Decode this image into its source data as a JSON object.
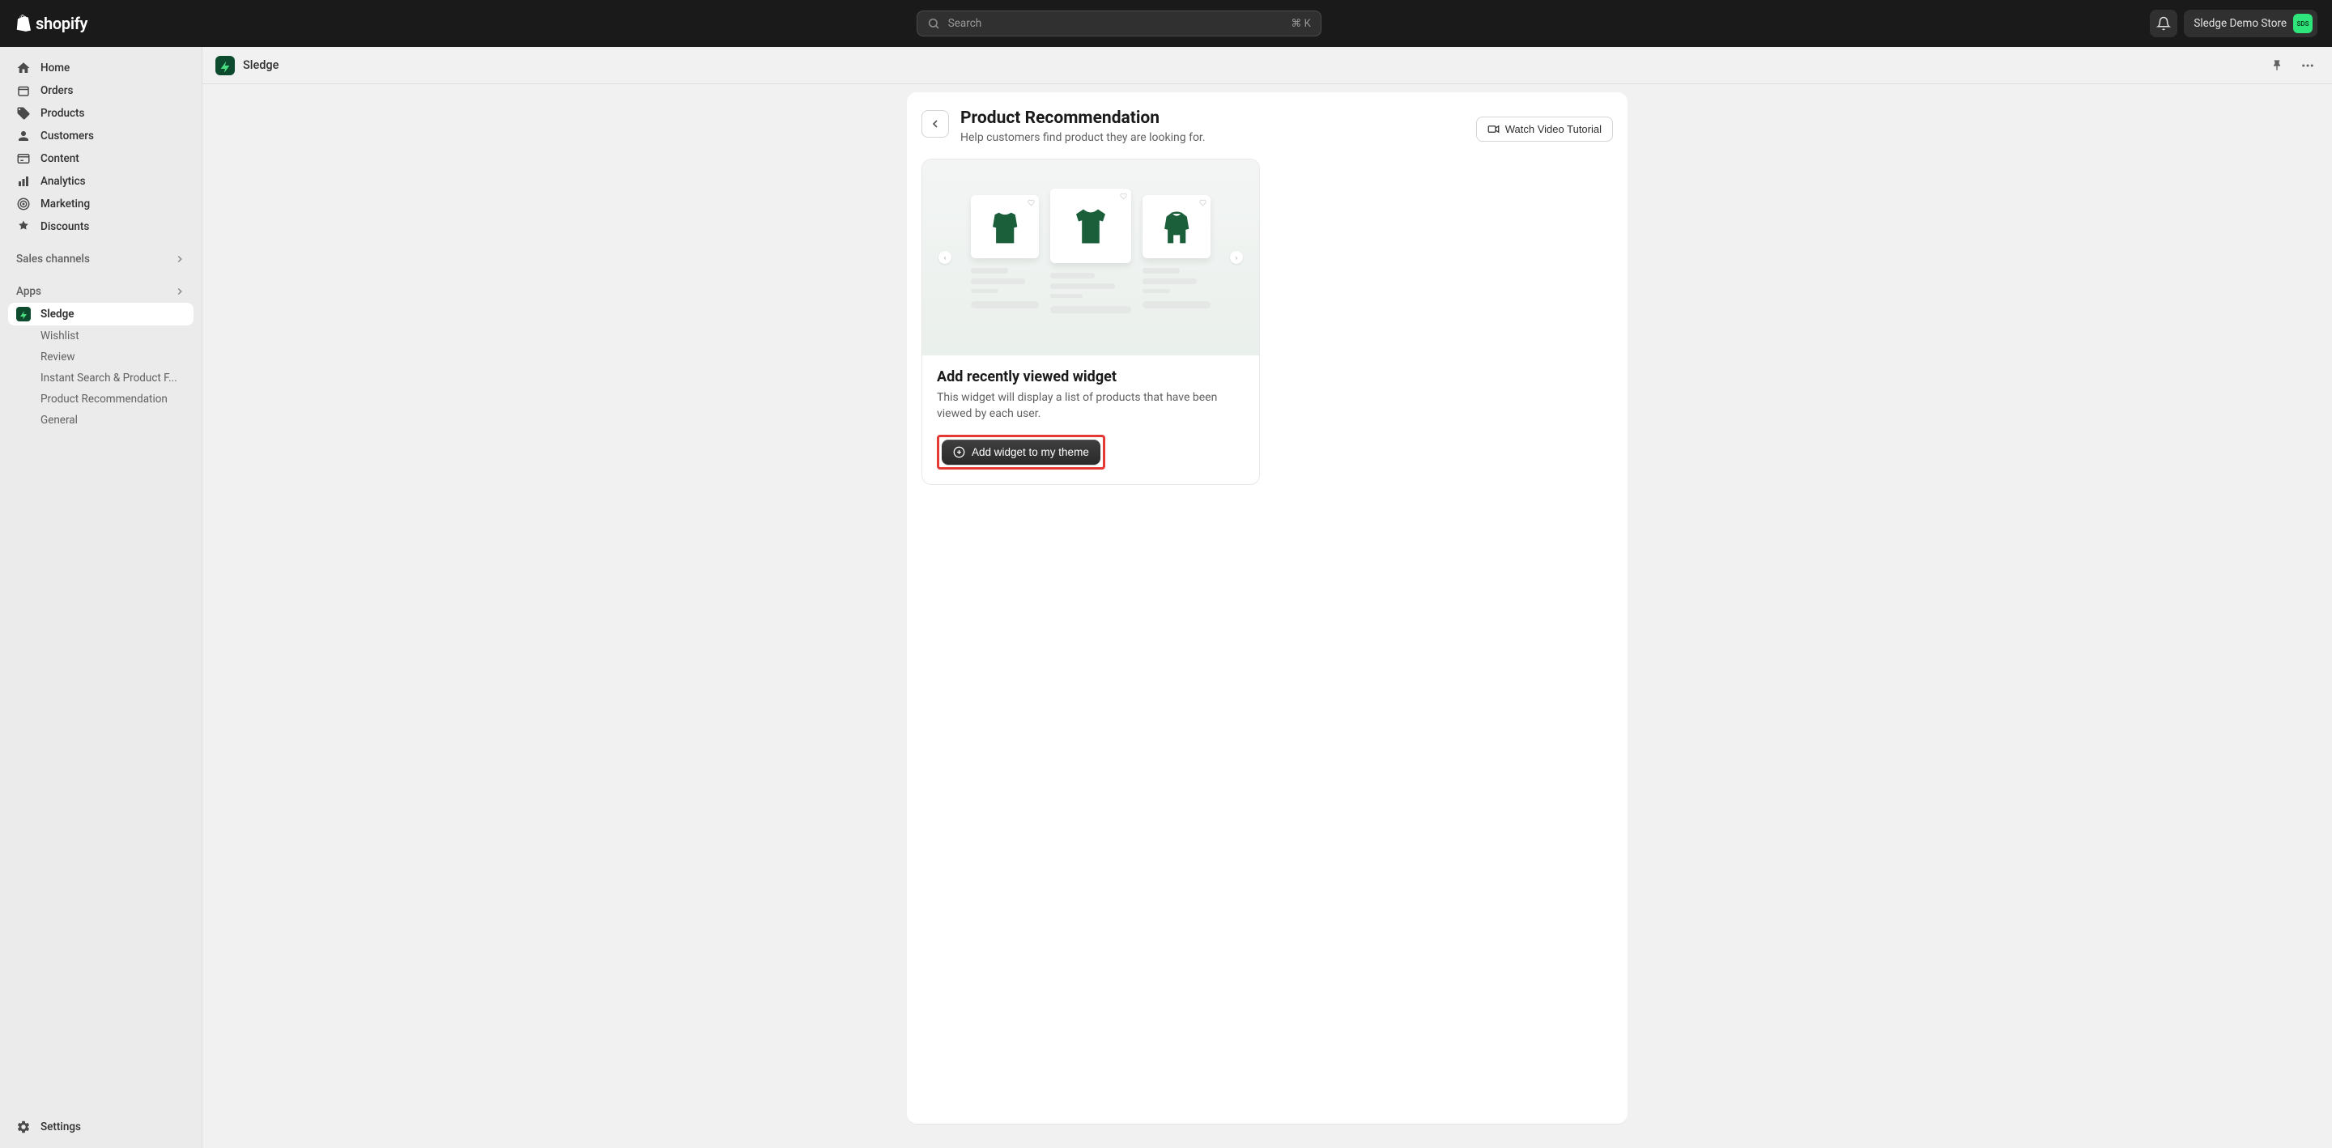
{
  "topbar": {
    "search_placeholder": "Search",
    "search_shortcut": "⌘ K",
    "store_name": "Sledge Demo Store",
    "store_initials": "SDS"
  },
  "sidebar": {
    "items": [
      {
        "label": "Home"
      },
      {
        "label": "Orders"
      },
      {
        "label": "Products"
      },
      {
        "label": "Customers"
      },
      {
        "label": "Content"
      },
      {
        "label": "Analytics"
      },
      {
        "label": "Marketing"
      },
      {
        "label": "Discounts"
      }
    ],
    "sales_channels_label": "Sales channels",
    "apps_label": "Apps",
    "active_app": "Sledge",
    "sub_items": [
      {
        "label": "Wishlist"
      },
      {
        "label": "Review"
      },
      {
        "label": "Instant Search & Product F..."
      },
      {
        "label": "Product Recommendation"
      },
      {
        "label": "General"
      }
    ],
    "settings_label": "Settings"
  },
  "page": {
    "app_name": "Sledge",
    "title": "Product Recommendation",
    "subtitle": "Help customers find product they are looking for.",
    "tutorial_label": "Watch Video Tutorial",
    "widget": {
      "title": "Add recently viewed widget",
      "desc": "This widget will display a list of products that have been viewed by each user.",
      "button_label": "Add widget to my theme"
    }
  }
}
